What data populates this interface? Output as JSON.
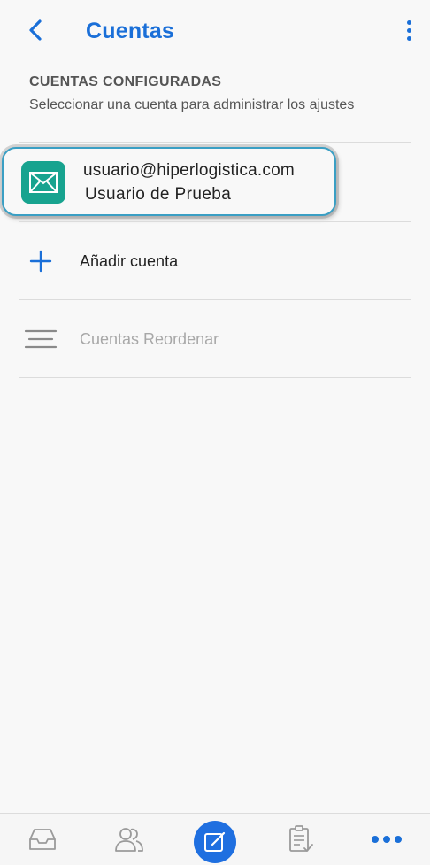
{
  "header": {
    "title": "Cuentas",
    "back_icon": "chevron-left-icon",
    "menu_icon": "kebab-menu-icon"
  },
  "section": {
    "heading": "CUENTAS CONFIGURADAS",
    "description": "Seleccionar una cuenta para administrar los ajustes"
  },
  "account": {
    "email": "usuario@hiperlogistica.com",
    "name": "Usuario de Prueba",
    "icon": "mail-icon",
    "icon_color": "#17a38f"
  },
  "actions": {
    "add_label": "Añadir cuenta",
    "add_icon": "plus-icon",
    "reorder_label": "Cuentas Reordenar",
    "reorder_icon": "reorder-icon"
  },
  "bottom_nav": {
    "tabs": [
      {
        "icon": "inbox-icon"
      },
      {
        "icon": "contacts-icon"
      },
      {
        "icon": "compose-icon"
      },
      {
        "icon": "tasks-icon"
      },
      {
        "icon": "more-icon"
      }
    ]
  },
  "colors": {
    "accent": "#1a6fd8",
    "highlight_border": "#3a9fc4",
    "compose_bg": "#1f6fe0"
  }
}
